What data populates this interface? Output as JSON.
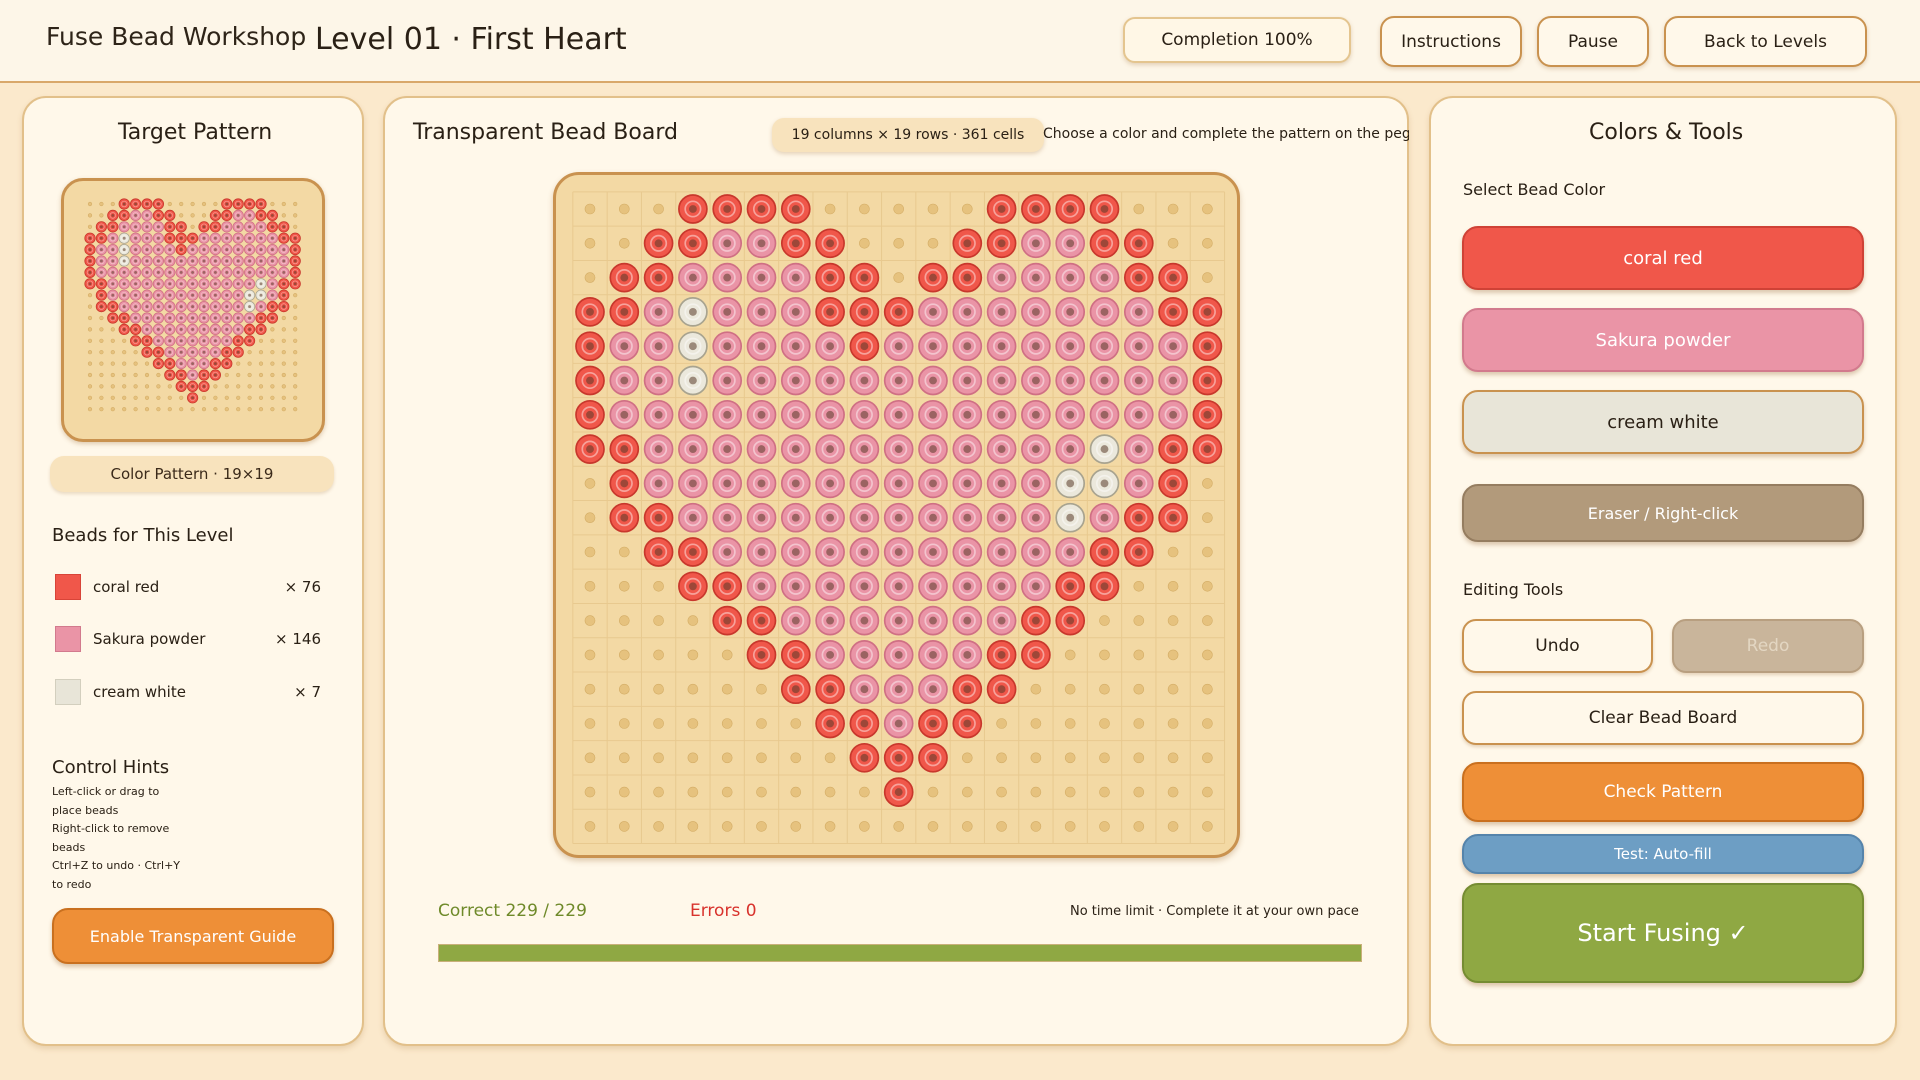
{
  "header": {
    "app_title": "Fuse Bead Workshop",
    "level_title": "Level 01 · First Heart",
    "completion": "Completion 100%",
    "instructions_label": "Instructions",
    "pause_label": "Pause",
    "back_label": "Back to Levels"
  },
  "left_panel": {
    "title": "Target Pattern",
    "pattern_tag": "Color Pattern · 19×19",
    "beads_title": "Beads for This Level",
    "beads": [
      {
        "name": "coral red",
        "count": "× 76",
        "color": "#f0574a"
      },
      {
        "name": "Sakura powder",
        "count": "× 146",
        "color": "#ea94a6"
      },
      {
        "name": "cream white",
        "count": "× 7",
        "color": "#e8e5d8"
      }
    ],
    "hints_title": "Control Hints",
    "hints": [
      "Left-click or drag to",
      "place beads",
      "Right-click to remove",
      "beads",
      "Ctrl+Z to undo · Ctrl+Y",
      "to redo"
    ],
    "guide_label": "Enable Transparent Guide"
  },
  "center_panel": {
    "title": "Transparent Bead Board",
    "grid_info": "19 columns × 19 rows · 361 cells",
    "instruction": "Choose a color and complete the pattern on the pegboard",
    "correct": "Correct 229 / 229",
    "errors": "Errors 0",
    "time_note": "No time limit · Complete it at your own pace",
    "progress": 1.0
  },
  "right_panel": {
    "title": "Colors & Tools",
    "select_label": "Select Bead Color",
    "colors": [
      {
        "label": "coral red",
        "bg": "#f0574a"
      },
      {
        "label": "Sakura powder",
        "bg": "#ea94a6"
      },
      {
        "label": "cream white",
        "bg": "#e8e5d8"
      }
    ],
    "eraser_label": "Eraser / Right-click",
    "tools_title": "Editing Tools",
    "undo_label": "Undo",
    "redo_label": "Redo",
    "clear_label": "Clear Bead Board",
    "check_label": "Check Pattern",
    "autofill_label": "Test: Auto-fill",
    "fuse_label": "Start Fusing ✓"
  },
  "colors": {
    "coral": "#f0574a",
    "sakura": "#ea94a6",
    "cream": "#ebe8dc",
    "board": "#f3d9a4",
    "peg": "#e6c27e",
    "accent_orange": "#ee8f37",
    "accent_green": "#8fa843",
    "accent_blue": "#6d9ec4"
  },
  "pattern": [
    "...RRRR.....RRRR...",
    "..RRSSRR...RRSSRR..",
    ".RRSSSSRR.RRSSSSRR.",
    "RRSWSSSRRRSSSSSSSRR",
    "RSSWSSSSRSSSSSSSSSR",
    "RSSWSSSSSSSSSSSSSSR",
    "RSSSSSSSSSSSSSSSSSR",
    "RRSSSSSSSSSSSSSWSRR",
    ".RSSSSSSSSSSSSWWSR.",
    ".RRSSSSSSSSSSSWSRR.",
    "..RRSSSSSSSSSSSRR..",
    "...RRSSSSSSSSSRR...",
    "....RRSSSSSSSRR....",
    ".....RRSSSSSRR.....",
    "......RRSSSRR......",
    ".......RRSRR.......",
    "........RRR........",
    ".........R.........",
    "..................."
  ]
}
